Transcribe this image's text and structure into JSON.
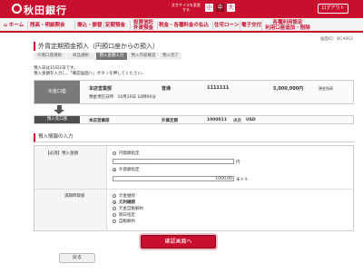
{
  "header": {
    "bank_name": "秋田銀行",
    "font_size_label": "文字サイズを変更する",
    "font_sizes": [
      "小",
      "中",
      "大"
    ],
    "logout_label": "ログアウト"
  },
  "nav": {
    "items": [
      "ホーム",
      "残高・明細照会",
      "振込・振替",
      "定期預金",
      "投資信託\n外貨預金",
      "税金・各種料金の払込",
      "住宅ローン",
      "電子交付",
      "各種利用設定\n利用口座追加・削除"
    ]
  },
  "screen_id": "画面ID：BCA003",
  "page_title": "外貨定期預金預入（円預口座からの預入）",
  "steps": [
    "引落口座選択",
    "商品選択",
    "預入金額入力",
    "預入内容確認",
    "預入完了"
  ],
  "instructions": {
    "line1": "預入日は15日2日です。",
    "line2": "預入金額を入力し、「確認画面へ」ボタンを押してください。"
  },
  "source_account": {
    "label": "出金口座",
    "branch": "本店営業部",
    "type": "普通",
    "number": "1111111",
    "balance": "5,000,000円",
    "balance_suffix": "預金残高",
    "available_note": "預金現在日時　10月20日 10時00分"
  },
  "dest_account": {
    "label": "預入先口座",
    "branch": "本店営業部",
    "type": "外貨定期",
    "number": "1000011",
    "currency_label": "通貨",
    "currency": "USD"
  },
  "form": {
    "section_title": "預入情報の入力",
    "required_badge": "【必須】",
    "amount_label": "預入金額",
    "option_yen": "円貨額指定",
    "yen_unit": "円",
    "option_foreign": "外貨額指定",
    "foreign_value": "1000.00",
    "foreign_unit": "米ドル",
    "maturity_label": "満期時取扱",
    "maturity_options": [
      "元金継続",
      "元利継続",
      "元金自動解約",
      "期日指定",
      "自動解約"
    ]
  },
  "buttons": {
    "confirm": "確認画面へ",
    "back": "戻る"
  }
}
